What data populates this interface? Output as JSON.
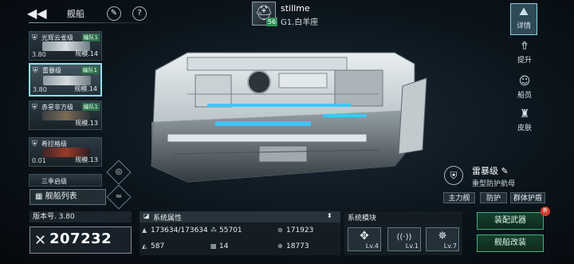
{
  "header": {
    "title": "舰船",
    "back_glyph": "◀◀",
    "paint_glyph": "✎",
    "help_glyph": "?"
  },
  "player": {
    "name": "stillme",
    "rank": "G1.白羊座",
    "level": "56",
    "avatar_icon": "helmet-icon"
  },
  "ship_list": [
    {
      "name": "光辉云雀级",
      "fleet": "编队1",
      "version": "3.80",
      "scale": "规模.14"
    },
    {
      "name": "雷暴级",
      "fleet": "编队1",
      "version": "3.80",
      "scale": "规模.14",
      "selected": true
    },
    {
      "name": "赤星非方级",
      "fleet": "编队1",
      "version": "",
      "scale": "规模.13"
    },
    {
      "name": "希拉格级",
      "fleet": "",
      "version": "0.01",
      "scale": "规模.13"
    },
    {
      "name": "三季启级",
      "fleet": "",
      "version": "",
      "scale": ""
    }
  ],
  "list_button": {
    "label": "舰船列表",
    "icon": "grid-icon"
  },
  "right_nav": [
    {
      "label": "详情",
      "icon": "details-icon",
      "glyph": "⛰",
      "active": true
    },
    {
      "label": "提升",
      "icon": "upgrade-icon",
      "glyph": "⇮"
    },
    {
      "label": "船员",
      "icon": "crew-icon",
      "glyph": "☺"
    },
    {
      "label": "皮肤",
      "icon": "skin-icon",
      "glyph": "♜"
    }
  ],
  "ship_info": {
    "class_name": "雷暴级",
    "edit_glyph": "✎",
    "type": "重型防护航母",
    "tags": [
      "主力舰",
      "防护",
      "群体护盾"
    ]
  },
  "version": {
    "label": "版本号. 3.80"
  },
  "power": {
    "value": "207232",
    "icon": "swords-icon"
  },
  "attributes": {
    "title": "系统属性",
    "rows": [
      [
        "173634/173634",
        "55701",
        "171923"
      ],
      [
        "587",
        "14",
        "18773"
      ]
    ]
  },
  "modules": {
    "title": "系统模块",
    "items": [
      {
        "icon": "cross-arrows-icon",
        "glyph": "✥",
        "level": "Lv.4"
      },
      {
        "icon": "signal-icon",
        "glyph": "((·))",
        "level": "Lv.1"
      },
      {
        "icon": "compass-icon",
        "glyph": "✵",
        "level": "Lv.7"
      }
    ]
  },
  "actions": {
    "equip_weapon": "装配武器",
    "modify_ship": "舰船改装",
    "new_badge": "新"
  },
  "colors": {
    "accent_green": "#3fb27a",
    "selected_border": "#8ee0e8",
    "ship_glow": "#3fc6ff"
  }
}
